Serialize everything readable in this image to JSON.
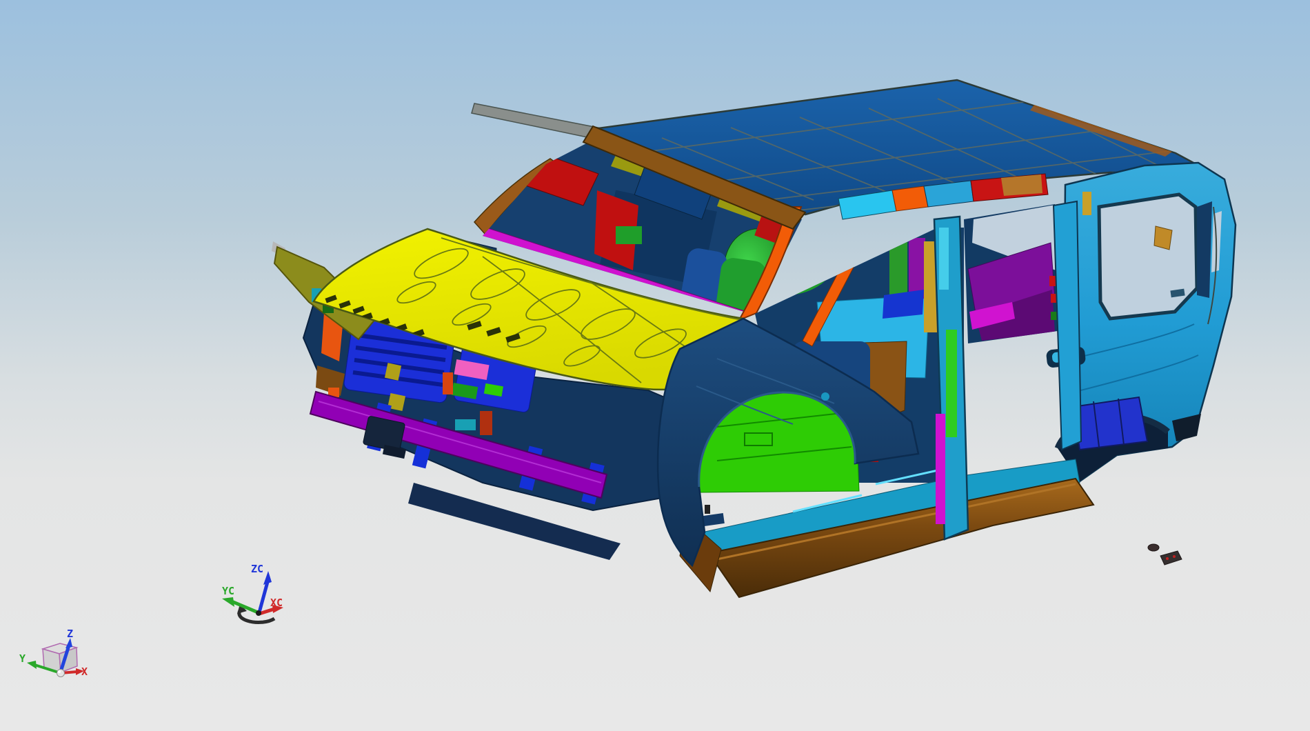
{
  "viewport": {
    "type": "3d-cad-viewport",
    "background_top": "#9cc0de",
    "background_bottom": "#e8e8e8",
    "window_sky": "#c0d1de"
  },
  "model": {
    "name": "suv-body-in-white-assembly",
    "palette": {
      "roof": "#17599c",
      "hood": "#ebeb00",
      "front_fender": "#173f6b",
      "rear_quarter": "#219cd4",
      "rocker_sill": "#7c4a11",
      "floor_green": "#2ecc05",
      "floor_brown": "#8a5315",
      "floor_cyan": "#2cb5e6",
      "radiator_support": "#1b2fd8",
      "bumper_beam": "#9100b5",
      "a_pillar_orange": "#f25c07",
      "front_header": "#7c4a12",
      "cowl_magenta": "#cf12cf",
      "interior_purple": "#8912a4",
      "interior_red": "#c81414",
      "wheelhouse_green": "#28a22c",
      "sill_teal": "#189cc6",
      "pillar_gold": "#c9a02a",
      "apron_olive": "#8c8c1c"
    }
  },
  "wcs_triad": {
    "z_label": "ZC",
    "y_label": "YC",
    "x_label": "XC",
    "z_color": "#2036d8",
    "y_color": "#2aa82a",
    "x_color": "#d02a2a"
  },
  "abs_triad": {
    "z_label": "Z",
    "y_label": "Y",
    "x_label": "X",
    "z_color": "#2244dd",
    "y_color": "#2aa82a",
    "x_color": "#d02a2a"
  }
}
